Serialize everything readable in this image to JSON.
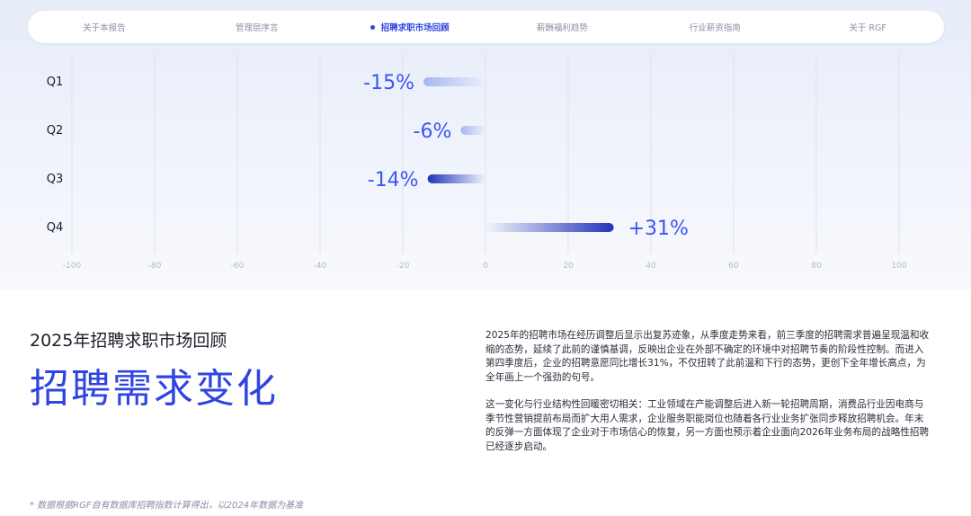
{
  "nav": {
    "items": [
      {
        "label": "关于本报告",
        "active": false
      },
      {
        "label": "管理层序言",
        "active": false
      },
      {
        "label": "招聘求职市场回顾",
        "active": true
      },
      {
        "label": "薪酬福利趋势",
        "active": false
      },
      {
        "label": "行业薪资指南",
        "active": false
      },
      {
        "label": "关于 RGF",
        "active": false
      }
    ]
  },
  "chart_data": {
    "type": "bar",
    "orientation": "horizontal",
    "categories": [
      "Q1",
      "Q2",
      "Q3",
      "Q4"
    ],
    "values": [
      -15,
      -6,
      -14,
      31
    ],
    "data_labels": [
      "-15%",
      "-6%",
      "-14%",
      "+31%"
    ],
    "xlim": [
      -100,
      100
    ],
    "xticks": [
      -100,
      -80,
      -60,
      -40,
      -20,
      0,
      20,
      40,
      60,
      80,
      100
    ],
    "grid": true,
    "colors": {
      "bar": "#2233b8",
      "label": "#3d55f2",
      "grid": "#dde2ee",
      "tick": "#b4b9c8"
    }
  },
  "section": {
    "subtitle": "2025年招聘求职市场回顾",
    "title": "招聘需求变化"
  },
  "body": {
    "p1": "2025年的招聘市场在经历调整后显示出复苏迹象，从季度走势来看，前三季度的招聘需求普遍呈现温和收缩的态势，延续了此前的谨慎基调，反映出企业在外部不确定的环境中对招聘节奏的阶段性控制。而进入第四季度后，企业的招聘意愿同比增长31%，不仅扭转了此前温和下行的态势，更创下全年增长高点，为全年画上一个强劲的句号。",
    "p2": "这一变化与行业结构性回暖密切相关：工业领域在产能调整后进入新一轮招聘周期，消费品行业因电商与季节性营销提前布局而扩大用人需求，企业服务职能岗位也随着各行业业务扩张同步释放招聘机会。年末的反弹一方面体现了企业对于市场信心的恢复，另一方面也预示着企业面向2026年业务布局的战略性招聘已经逐步启动。"
  },
  "footnote": "* 数据根据RGF自有数据库招聘指数计算得出，以2024年数据为基准"
}
